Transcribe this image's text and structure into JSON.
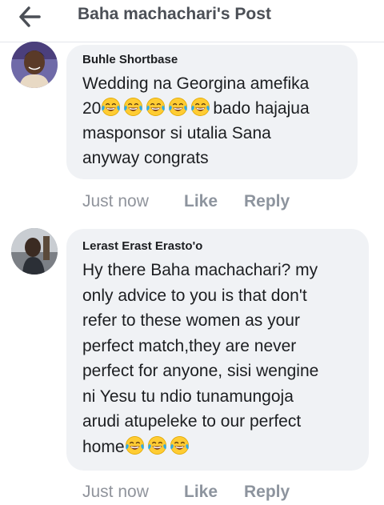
{
  "header": {
    "title": "Baha machachari's Post"
  },
  "comments": [
    {
      "author": "Buhle Shortbase",
      "lines": [
        "Wedding na Georgina amefika",
        "bado hajajua",
        "masponsor si utalia Sana",
        "anyway congrats"
      ],
      "line2_prefix": "20",
      "time": "Just now",
      "like_label": "Like",
      "reply_label": "Reply"
    },
    {
      "author": "Lerast Erast Erasto'o",
      "lines": [
        "Hy there Baha machachari? my",
        "only advice to you is that don't",
        "refer to these women as your",
        "perfect match,they are never",
        "perfect for anyone, sisi wengine",
        "ni Yesu tu ndio tunamungoja",
        "arudi atupeleke to our perfect",
        "home"
      ],
      "time": "Just now",
      "like_label": "Like",
      "reply_label": "Reply"
    }
  ],
  "icons": {
    "back": "arrow-left-icon",
    "emoji": "face-with-tears-of-joy-icon"
  },
  "colors": {
    "bubble": "#f0f2f5",
    "meta": "#90949c",
    "emoji_face": "#ffcc33",
    "tear": "#2fa9e6"
  }
}
